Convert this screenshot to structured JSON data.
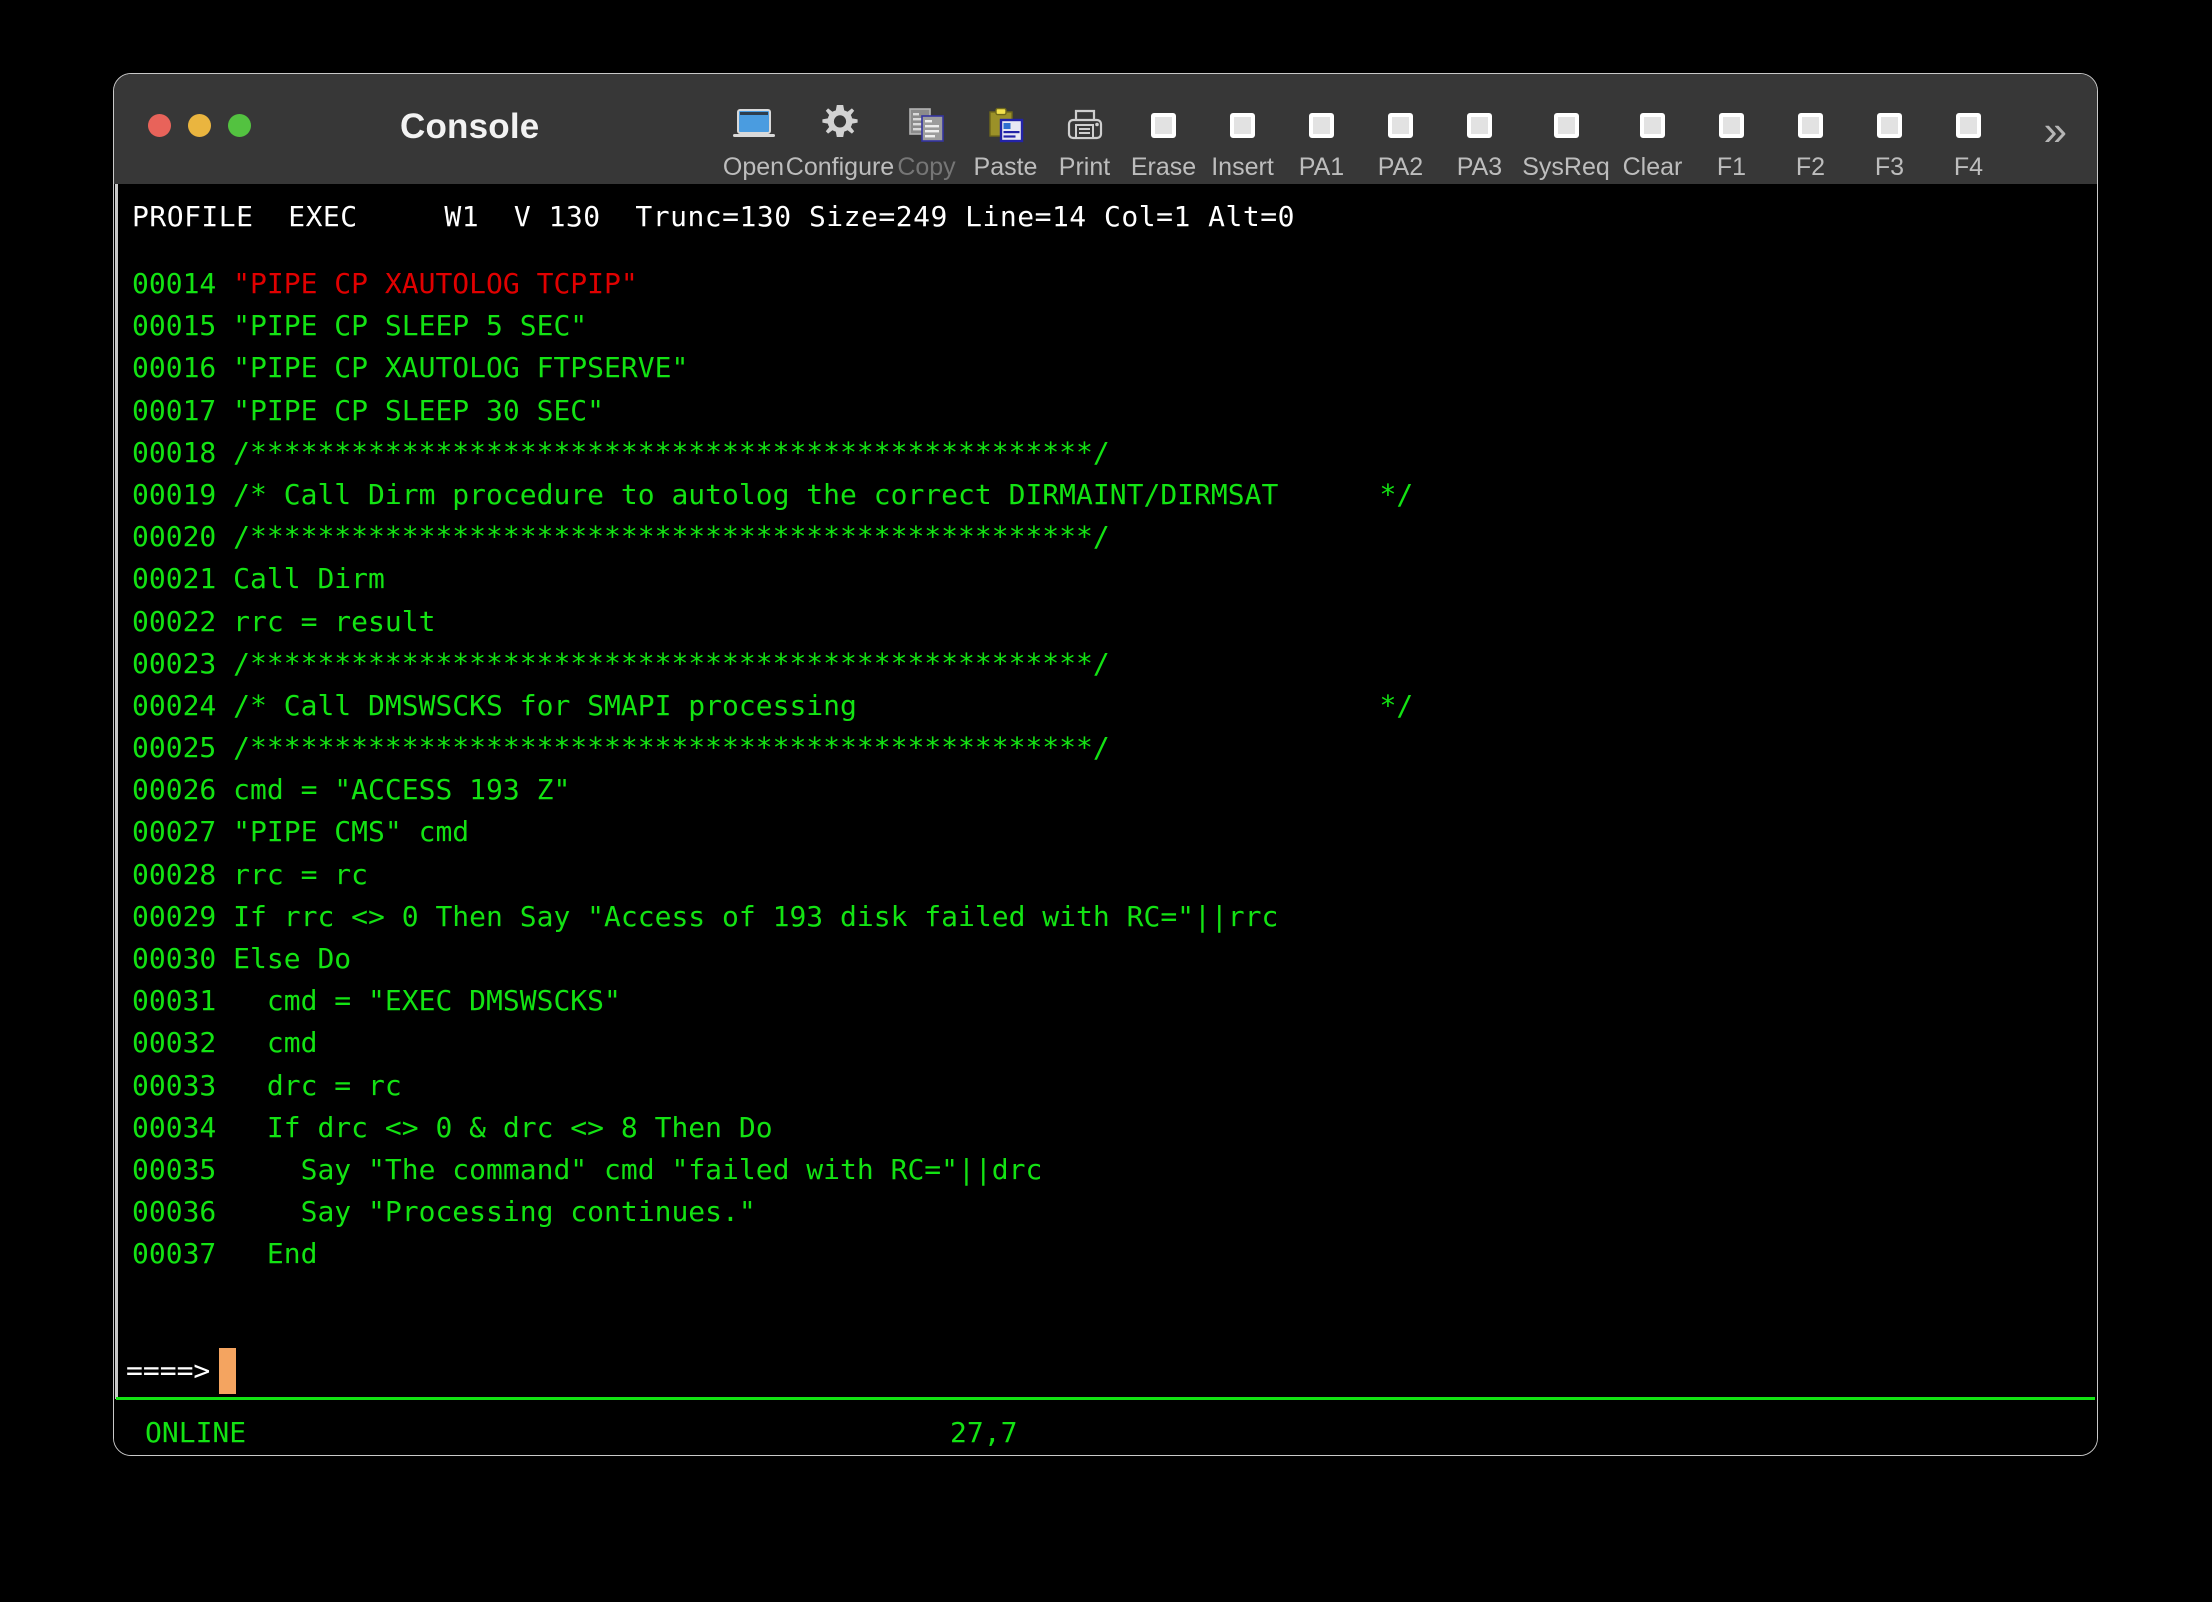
{
  "window": {
    "title": "Console",
    "traffic_lights": [
      {
        "name": "close",
        "color": "#e8635a"
      },
      {
        "name": "minimize",
        "color": "#eab53f"
      },
      {
        "name": "zoom",
        "color": "#53c240"
      }
    ],
    "overflow_label": "»"
  },
  "toolbar": {
    "items": [
      {
        "label": "Open",
        "icon": "laptop-icon",
        "disabled": false
      },
      {
        "label": "Configure",
        "icon": "gear-icon",
        "disabled": false
      },
      {
        "label": "Copy",
        "icon": "copy-icon",
        "disabled": true
      },
      {
        "label": "Paste",
        "icon": "paste-icon",
        "disabled": false
      },
      {
        "label": "Print",
        "icon": "printer-icon",
        "disabled": false
      },
      {
        "label": "Erase",
        "icon": "square-icon",
        "disabled": false
      },
      {
        "label": "Insert",
        "icon": "square-icon",
        "disabled": false
      },
      {
        "label": "PA1",
        "icon": "square-icon",
        "disabled": false
      },
      {
        "label": "PA2",
        "icon": "square-icon",
        "disabled": false
      },
      {
        "label": "PA3",
        "icon": "square-icon",
        "disabled": false
      },
      {
        "label": "SysReq",
        "icon": "square-icon",
        "disabled": false
      },
      {
        "label": "Clear",
        "icon": "square-icon",
        "disabled": false
      },
      {
        "label": "F1",
        "icon": "square-icon",
        "disabled": false
      },
      {
        "label": "F2",
        "icon": "square-icon",
        "disabled": false
      },
      {
        "label": "F3",
        "icon": "square-icon",
        "disabled": false
      },
      {
        "label": "F4",
        "icon": "square-icon",
        "disabled": false
      }
    ]
  },
  "terminal": {
    "header_line": "PROFILE  EXEC     W1  V 130  Trunc=130 Size=249 Line=14 Col=1 Alt=0",
    "file": {
      "name": "PROFILE",
      "type": "EXEC",
      "mode": "W1",
      "recfm": "V",
      "lrecl": "130",
      "trunc": "130",
      "size": "249",
      "line": "14",
      "col": "1",
      "alt": "0"
    },
    "lines": [
      {
        "num": "00014",
        "text": "\"PIPE CP XAUTOLOG TCPIP\"",
        "color": "red"
      },
      {
        "num": "00015",
        "text": "\"PIPE CP SLEEP 5 SEC\"",
        "color": "green"
      },
      {
        "num": "00016",
        "text": "\"PIPE CP XAUTOLOG FTPSERVE\"",
        "color": "green"
      },
      {
        "num": "00017",
        "text": "\"PIPE CP SLEEP 30 SEC\"",
        "color": "green"
      },
      {
        "num": "00018",
        "text": "/**************************************************/",
        "color": "green"
      },
      {
        "num": "00019",
        "text": "/* Call Dirm procedure to autolog the correct DIRMAINT/DIRMSAT      */",
        "color": "green"
      },
      {
        "num": "00020",
        "text": "/**************************************************/",
        "color": "green"
      },
      {
        "num": "00021",
        "text": "Call Dirm",
        "color": "green"
      },
      {
        "num": "00022",
        "text": "rrc = result",
        "color": "green"
      },
      {
        "num": "00023",
        "text": "/**************************************************/",
        "color": "green"
      },
      {
        "num": "00024",
        "text": "/* Call DMSWSCKS for SMAPI processing                               */",
        "color": "green"
      },
      {
        "num": "00025",
        "text": "/**************************************************/",
        "color": "green"
      },
      {
        "num": "00026",
        "text": "cmd = \"ACCESS 193 Z\"",
        "color": "green"
      },
      {
        "num": "00027",
        "text": "\"PIPE CMS\" cmd",
        "color": "green"
      },
      {
        "num": "00028",
        "text": "rrc = rc",
        "color": "green"
      },
      {
        "num": "00029",
        "text": "If rrc <> 0 Then Say \"Access of 193 disk failed with RC=\"||rrc",
        "color": "green"
      },
      {
        "num": "00030",
        "text": "Else Do",
        "color": "green"
      },
      {
        "num": "00031",
        "text": "  cmd = \"EXEC DMSWSCKS\"",
        "color": "green"
      },
      {
        "num": "00032",
        "text": "  cmd",
        "color": "green"
      },
      {
        "num": "00033",
        "text": "  drc = rc",
        "color": "green"
      },
      {
        "num": "00034",
        "text": "  If drc <> 0 & drc <> 8 Then Do",
        "color": "green"
      },
      {
        "num": "00035",
        "text": "    Say \"The command\" cmd \"failed with RC=\"||drc",
        "color": "green"
      },
      {
        "num": "00036",
        "text": "    Say \"Processing continues.\"",
        "color": "green"
      },
      {
        "num": "00037",
        "text": "  End",
        "color": "green"
      }
    ],
    "command_prompt": "====>",
    "command_value": "",
    "status": {
      "connection": "ONLINE",
      "cursor_position": "27,7"
    }
  }
}
